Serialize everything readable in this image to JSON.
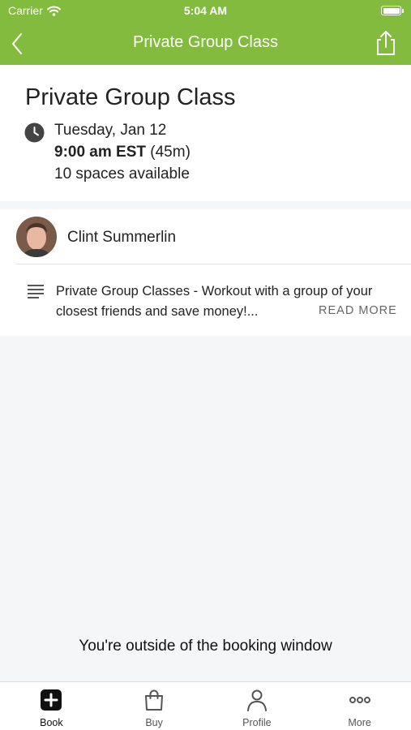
{
  "status_bar": {
    "carrier": "Carrier",
    "time": "5:04 AM"
  },
  "nav": {
    "title": "Private Group Class",
    "back_icon": "chevron-left-icon",
    "share_icon": "share-icon"
  },
  "class_info": {
    "title": "Private Group Class",
    "date": "Tuesday, Jan 12",
    "time": "9:00 am EST",
    "duration": "(45m)",
    "spaces": "10 spaces available"
  },
  "instructor": {
    "name": "Clint Summerlin"
  },
  "description": {
    "text": "Private Group Classes - Workout with a group of your closest friends and save money!...",
    "read_more": "READ MORE"
  },
  "notice": "You're outside of the booking window",
  "tabs": [
    {
      "label": "Book",
      "icon": "plus-square-icon",
      "active": true
    },
    {
      "label": "Buy",
      "icon": "shopping-bag-icon",
      "active": false
    },
    {
      "label": "Profile",
      "icon": "person-icon",
      "active": false
    },
    {
      "label": "More",
      "icon": "more-dots-icon",
      "active": false
    }
  ],
  "colors": {
    "accent": "#83bb3f",
    "background": "#f5f6f8"
  }
}
